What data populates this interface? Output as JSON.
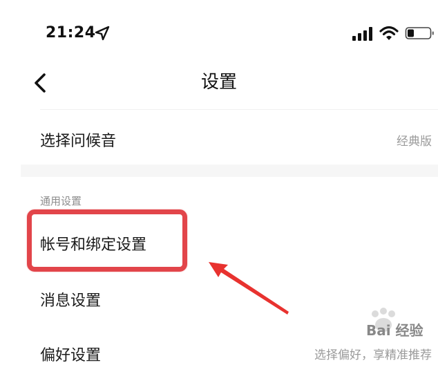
{
  "status_bar": {
    "time": "21:24",
    "icons": [
      "location-arrow-icon",
      "signal-icon",
      "wifi-icon",
      "battery-icon"
    ]
  },
  "nav": {
    "back_icon": "chevron-left-icon",
    "title": "设置"
  },
  "rows": {
    "greeting": {
      "label": "选择问候音",
      "value": "经典版"
    },
    "section_title": "通用设置",
    "account": {
      "label": "帐号和绑定设置"
    },
    "message": {
      "label": "消息设置"
    },
    "preference": {
      "label": "偏好设置",
      "value": "选择偏好，享精准推荐"
    }
  },
  "annotation": {
    "highlight_color": "#e2454a",
    "arrow_color": "#e8322f"
  },
  "watermark": {
    "text": "Bai 经验"
  }
}
